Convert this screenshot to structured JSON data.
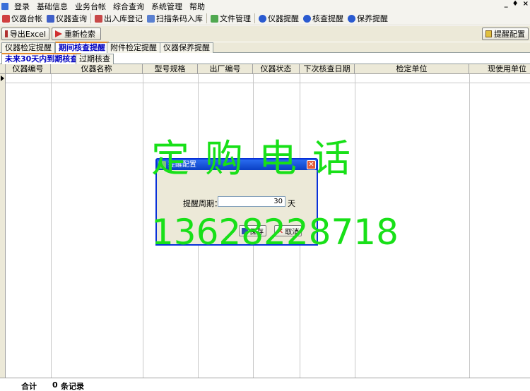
{
  "menubar": {
    "items": [
      "登录",
      "基础信息",
      "业务台帐",
      "综合查询",
      "系统管理",
      "帮助"
    ],
    "window_controls": [
      "_",
      "♦",
      "×"
    ]
  },
  "toolbar": {
    "items": [
      {
        "label": "仪器台帐",
        "icon": "ledger-icon",
        "color": "#c03030"
      },
      {
        "label": "仪器查询",
        "icon": "query-icon",
        "color": "#3050c0"
      },
      {
        "label": "出入库登记",
        "icon": "warehouse-icon",
        "color": "#c03030"
      },
      {
        "label": "扫描条码入库",
        "icon": "scan-icon",
        "color": "#3060c0"
      },
      {
        "label": "文件管理",
        "icon": "file-icon",
        "color": "#40a040"
      },
      {
        "label": "仪器提醒",
        "icon": "info-icon",
        "color": "#2050c0"
      },
      {
        "label": "核查提醒",
        "icon": "info-icon",
        "color": "#2050c0"
      },
      {
        "label": "保养提醒",
        "icon": "info-icon",
        "color": "#2050c0"
      }
    ]
  },
  "actions": {
    "export_label": "导出Excel",
    "research_label": "重新检索",
    "config_label": "提醒配置"
  },
  "tabs_main": [
    "仪器检定提醒",
    "期间核查提醒",
    "附件检定提醒",
    "仪器保养提醒"
  ],
  "tabs_main_active": 1,
  "tabs_sub": [
    "未来30天内到期核查",
    "过期核查"
  ],
  "tabs_sub_active": 0,
  "grid": {
    "columns": [
      "仪器编号",
      "仪器名称",
      "型号规格",
      "出厂编号",
      "仪器状态",
      "下次核查日期",
      "检定单位",
      "现使用单位"
    ]
  },
  "footer": {
    "total_label": "合计",
    "total_count": "0",
    "records_label": "条记录"
  },
  "dialog": {
    "title": "提醒配置",
    "period_label": "提醒周期：",
    "period_value": "30",
    "period_unit": "天",
    "save_label": "保存",
    "cancel_label": "取消"
  },
  "watermark": {
    "line1": "定购电话",
    "phone": "13628228718",
    "color": "#18e018"
  }
}
